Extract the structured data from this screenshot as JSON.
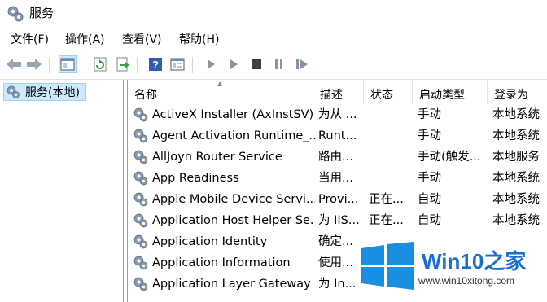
{
  "window": {
    "title": "服务"
  },
  "menu": [
    "文件(F)",
    "操作(A)",
    "查看(V)",
    "帮助(H)"
  ],
  "toolbar": {
    "buttons": [
      "back-icon",
      "forward-icon",
      "show-hide-console-tree-icon",
      "refresh-icon",
      "export-list-icon",
      "help-icon",
      "properties-icon",
      "start-service-icon",
      "start-service-alt-icon",
      "stop-service-icon",
      "pause-service-icon",
      "restart-service-icon"
    ]
  },
  "tree": {
    "selected_label": "服务(本地)"
  },
  "table": {
    "columns": [
      "名称",
      "描述",
      "状态",
      "启动类型",
      "登录为"
    ],
    "rows": [
      {
        "name": "ActiveX Installer (AxInstSV)",
        "desc": "为从 ...",
        "status": "",
        "startup": "手动",
        "logon": "本地系统"
      },
      {
        "name": "Agent Activation Runtime_...",
        "desc": "Runt...",
        "status": "",
        "startup": "手动",
        "logon": "本地系统"
      },
      {
        "name": "AllJoyn Router Service",
        "desc": "路由...",
        "status": "",
        "startup": "手动(触发...",
        "logon": "本地服务"
      },
      {
        "name": "App Readiness",
        "desc": "当用...",
        "status": "",
        "startup": "手动",
        "logon": "本地系统"
      },
      {
        "name": "Apple Mobile Device Servi...",
        "desc": "Provi...",
        "status": "正在...",
        "startup": "自动",
        "logon": "本地系统"
      },
      {
        "name": "Application Host Helper Se...",
        "desc": "为 IIS...",
        "status": "正在...",
        "startup": "自动",
        "logon": "本地系统"
      },
      {
        "name": "Application Identity",
        "desc": "确定...",
        "status": "",
        "startup": "",
        "logon": ""
      },
      {
        "name": "Application Information",
        "desc": "使用...",
        "status": "",
        "startup": "",
        "logon": ""
      },
      {
        "name": "Application Layer Gateway ...",
        "desc": "为 In...",
        "status": "",
        "startup": "",
        "logon": ""
      }
    ]
  },
  "watermark": {
    "brand": "Win10",
    "brand_suffix": "之家",
    "url": "www.win10xitong.com"
  },
  "colors": {
    "selection": "#cde8ff",
    "selection_border": "#99d1ff",
    "win_blue": "#1a8ee0",
    "brand_blue": "#1a6fd0"
  }
}
